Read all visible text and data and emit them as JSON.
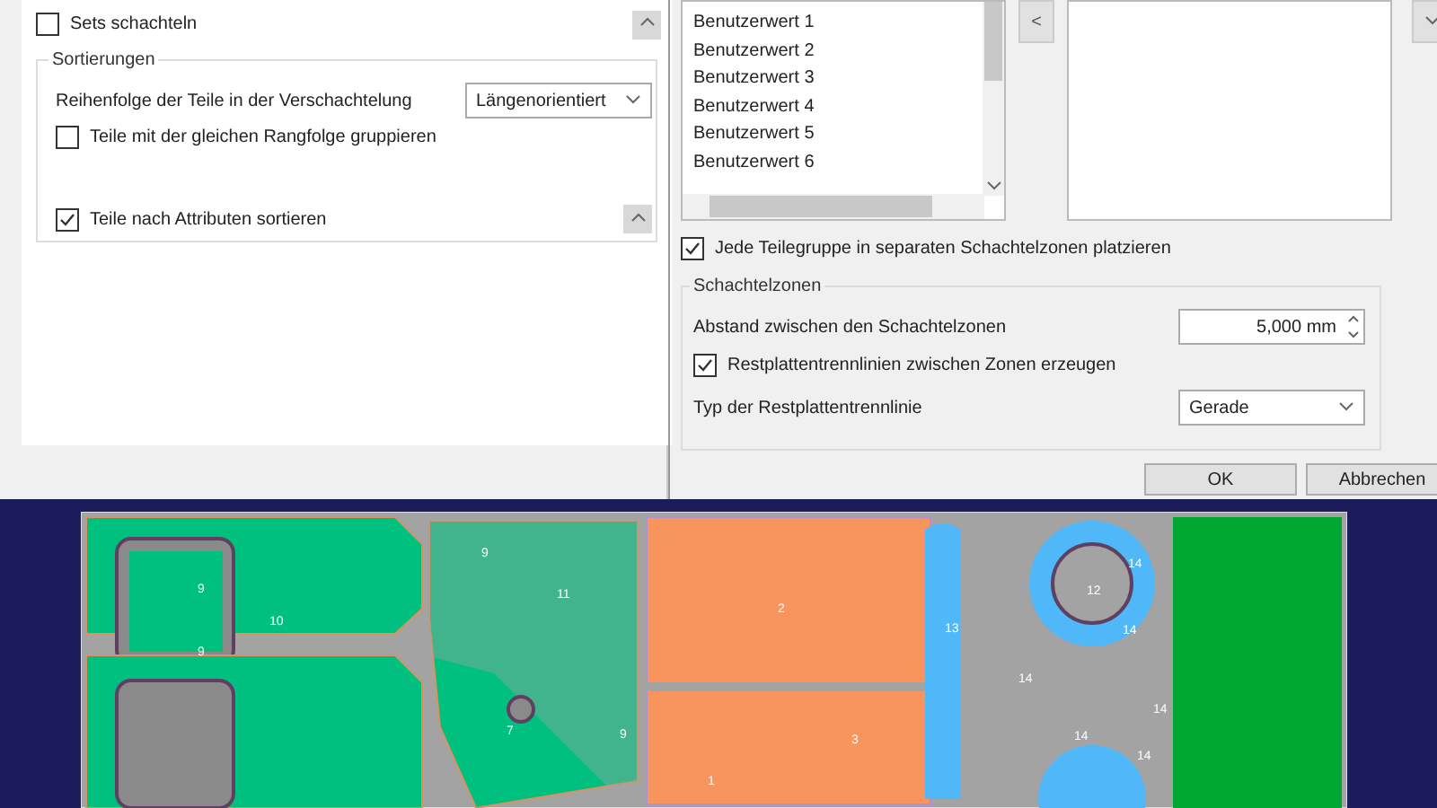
{
  "left_panel": {
    "sets_nesting": {
      "label": "Sets schachteln",
      "checked": false
    },
    "sorting": {
      "title": "Sortierungen",
      "order_label": "Reihenfolge der Teile in der Verschachtelung",
      "order_value": "Längenorientiert",
      "group_same_rank": {
        "label": "Teile mit der gleichen Rangfolge gruppieren",
        "checked": false
      },
      "sort_by_attributes": {
        "label": "Teile nach Attributen sortieren",
        "checked": true
      }
    }
  },
  "right_panel": {
    "available_list": [
      "Benutzerwert 1",
      "Benutzerwert 2",
      "Benutzerwert 3",
      "Benutzerwert 4",
      "Benutzerwert 5",
      "Benutzerwert 6"
    ],
    "move_left_button": "<",
    "separate_zones": {
      "label": "Jede Teilegruppe in separaten Schachtelzonen platzieren",
      "checked": true
    },
    "zones": {
      "title": "Schachtelzonen",
      "distance_label": "Abstand zwischen den Schachtelzonen",
      "distance_value": "5,000 mm",
      "remnant_lines": {
        "label": "Restplattentrennlinien zwischen Zonen erzeugen",
        "checked": true
      },
      "line_type_label": "Typ der Restplattentrennlinie",
      "line_type_value": "Gerade"
    },
    "buttons": [
      "OK",
      "Abbrechen"
    ]
  },
  "sheet": {
    "part_labels": [
      "9",
      "9",
      "10",
      "9",
      "11",
      "7",
      "9",
      "2",
      "3",
      "1",
      "13",
      "12",
      "14",
      "14",
      "14",
      "14",
      "14",
      "14"
    ]
  }
}
